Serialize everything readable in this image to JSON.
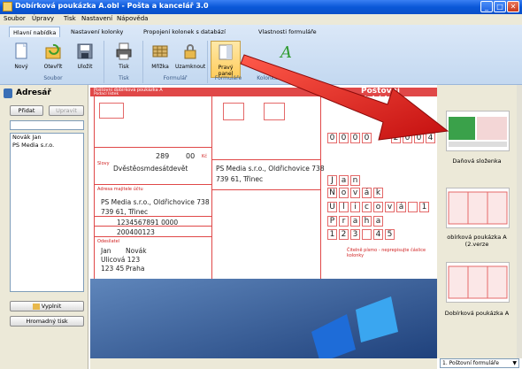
{
  "window": {
    "title": "Dobírková poukázka A.obl - Pošta a kancelář 3.0",
    "buttons": [
      "_",
      "□",
      "✕"
    ]
  },
  "menu": [
    "Soubor",
    "Úpravy",
    "Tisk",
    "Nastavení",
    "Nápověda"
  ],
  "ribbon": {
    "tabs": [
      "Hlavní nabídka",
      "Nastavení kolonky",
      "Propojení kolonek s databází",
      "Vlastnosti formuláře"
    ],
    "active_tab": "Hlavní nabídka",
    "buttons": [
      {
        "label": "Nový",
        "icon": "new-document-icon"
      },
      {
        "label": "Otevřít",
        "icon": "open-icon"
      },
      {
        "label": "Uložit",
        "icon": "save-icon"
      },
      {
        "label": "Tisk",
        "icon": "printer-icon"
      },
      {
        "label": "Mřížka",
        "icon": "grid-icon"
      },
      {
        "label": "Uzamknout",
        "icon": "lock-icon"
      },
      {
        "label": "Pravý panel",
        "icon": "right-panel-icon"
      },
      {
        "label": "",
        "icon": "text-icon"
      }
    ],
    "groups": [
      "Soubor",
      "Tisk",
      "Formulář",
      "Formuláře",
      "Kolonka"
    ]
  },
  "addressbook": {
    "title": "Adresář",
    "add_label": "Přidat",
    "edit_label": "Upravit",
    "entries": [
      "Novák Jan",
      "PS Media s.r.o."
    ],
    "fill_label": "Vyplnit",
    "bulk_print_label": "Hromadný tisk"
  },
  "form": {
    "header_left": "Poštovní dobírková poukázka A",
    "header_left_sub": "Podací lístek",
    "header_right": "Poštovní dobírkov",
    "amount": "289",
    "amount_cents": "00",
    "amount_words": "Dvěstěosmdesátdevět",
    "amount_label": "Slovy",
    "kc_label": "Kč",
    "addressee_label": "Adresa majitele účtu",
    "company": "PS Media s.r.o., Oldřichovice 738",
    "city": "739 61, Třinec",
    "account": "1234567891 0000",
    "vs": "200400123",
    "sender_label": "Odesílatel",
    "sender_first": "Jan",
    "sender_last": "Novák",
    "sender_street": "Ulicová 123",
    "sender_zip": "123 45",
    "sender_city": "Praha",
    "grid_digits_1": [
      "0",
      "0",
      "0",
      "0"
    ],
    "grid_digits_2": [
      "2",
      "0",
      "0",
      "4",
      "0"
    ],
    "grid_name": [
      "J",
      "a",
      "n"
    ],
    "grid_surname": [
      "N",
      "o",
      "v",
      "á",
      "k"
    ],
    "grid_street": [
      "U",
      "l",
      "i",
      "c",
      "o",
      "v",
      "á",
      "",
      "1"
    ],
    "grid_city": [
      "P",
      "r",
      "a",
      "h",
      "a"
    ],
    "grid_zip": [
      "1",
      "2",
      "3",
      "",
      "4",
      "5"
    ],
    "footer_note": "Čitelně písmo - neprepisujte čáslice kolonky"
  },
  "thumbnails": [
    {
      "label": "Daňová složenka"
    },
    {
      "label": "obírková poukázka A (2.verze"
    },
    {
      "label": "Dobírková poukázka A"
    }
  ],
  "combo": "1. Poštovní formuláře",
  "colors": {
    "accent": "#0a58d8",
    "form_red": "#d01f1f",
    "arrow": "#e02020"
  }
}
